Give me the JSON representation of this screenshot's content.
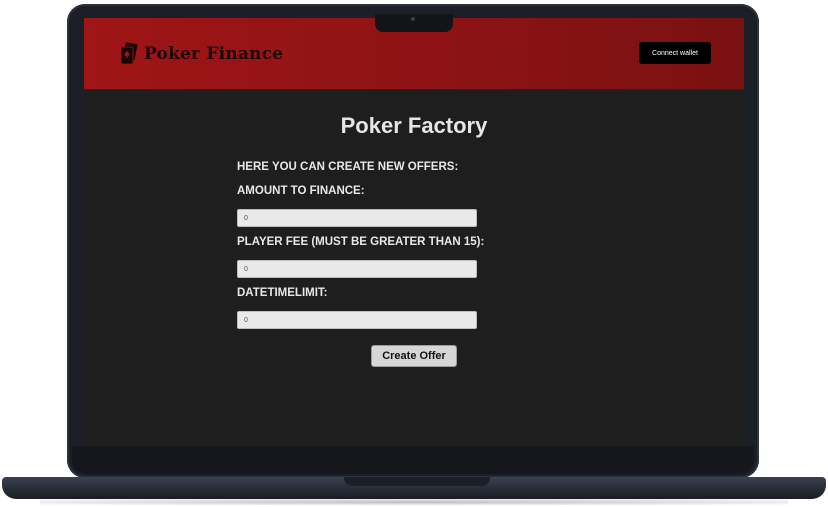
{
  "header": {
    "brand": "Poker Finance",
    "logo_icon": "poker-cards-icon",
    "connect_label": "Connect wallet",
    "accent_color": "#8d1314"
  },
  "main": {
    "title": "Poker Factory",
    "intro": "HERE YOU CAN CREATE NEW OFFERS:",
    "fields": [
      {
        "label": "AMOUNT TO FINANCE:",
        "value": "0"
      },
      {
        "label": "PLAYER FEE (MUST BE GREATER THAN 15):",
        "value": "0"
      },
      {
        "label": "DATETIMELIMIT:",
        "value": "0"
      }
    ],
    "submit_label": "Create Offer"
  }
}
